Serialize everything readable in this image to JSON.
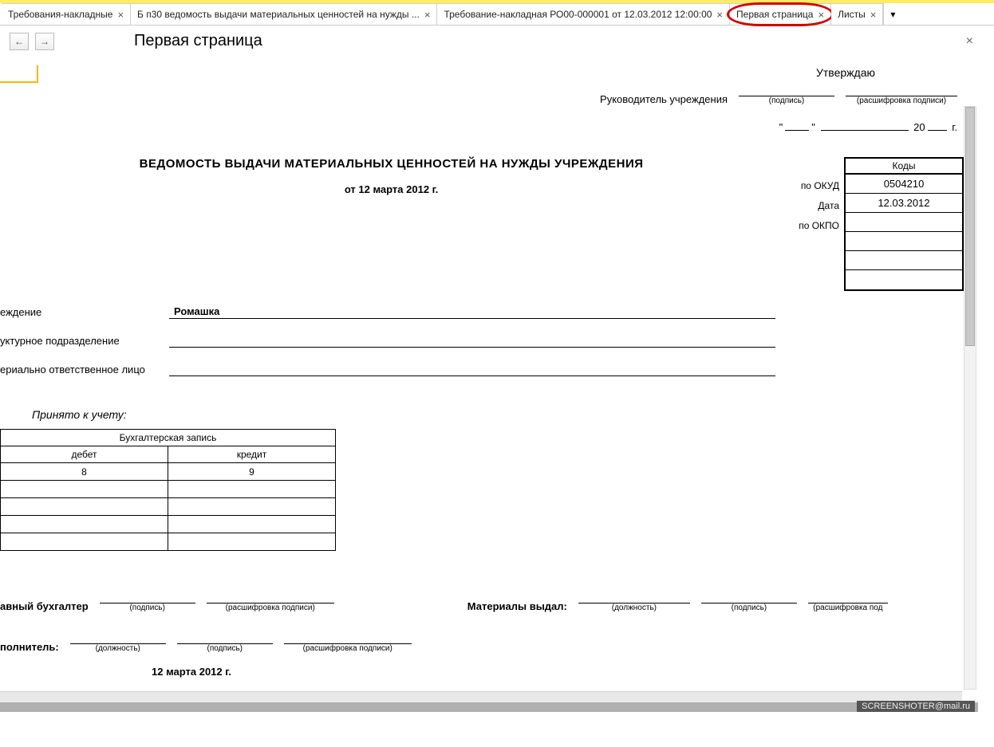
{
  "tabs": [
    {
      "label": "Требования-накладные"
    },
    {
      "label": "Б п30 ведомость выдачи материальных ценностей на нужды ..."
    },
    {
      "label": "Требование-накладная РО00-000001 от 12.03.2012 12:00:00"
    },
    {
      "label": "Первая страница"
    },
    {
      "label": "Листы"
    }
  ],
  "page_title": "Первая страница",
  "approve": {
    "title": "Утверждаю",
    "leader": "Руководитель учреждения",
    "sig_label": "(подпись)",
    "decode_label": "(расшифровка подписи)"
  },
  "date_suffix_year_prefix": "20",
  "date_suffix_year_unit": "г.",
  "main_title": "ВЕДОМОСТЬ ВЫДАЧИ МАТЕРИАЛЬНЫХ ЦЕННОСТЕЙ НА НУЖДЫ УЧРЕЖДЕНИЯ",
  "main_subtitle": "от 12 марта 2012 г.",
  "codes": {
    "header": "Коды",
    "labels": {
      "okud": "по ОКУД",
      "date": "Дата",
      "okpo": "по ОКПО"
    },
    "okud": "0504210",
    "date": "12.03.2012",
    "okpo": ""
  },
  "org": {
    "institution_label": "еждение",
    "institution_value": "Ромашка",
    "subdivision_label": "уктурное подразделение",
    "subdivision_value": "",
    "responsible_label": "ериально ответственное лицо",
    "responsible_value": ""
  },
  "accepted_title": "Принято к учету:",
  "acct": {
    "header": "Бухгалтерская запись",
    "debit": "дебет",
    "credit": "кредит",
    "row1_debit": "8",
    "row1_credit": "9"
  },
  "sig": {
    "chief_label": "авный бухгалтер",
    "executor_label": "полнитель:",
    "materials_label": "Материалы выдал:",
    "position": "(должность)",
    "signature": "(подпись)",
    "decode_short": "(расшифровка подписи)",
    "decode_cut": "(расшифровка под"
  },
  "footer_date": "12 марта 2012 г.",
  "watermark": "SCREENSHOTER@mail.ru"
}
